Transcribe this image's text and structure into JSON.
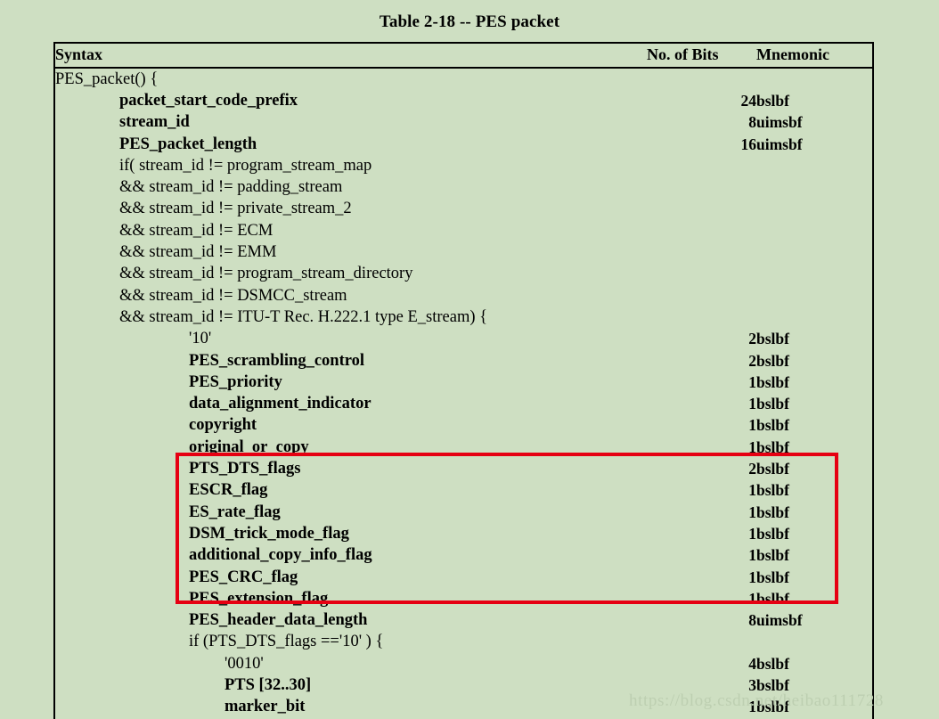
{
  "title": "Table 2-18 -- PES packet",
  "colors": {
    "page_background": "#cedfc2",
    "highlight_box": "#e60012",
    "table_border": "#000000",
    "watermark": "#bdcfb1"
  },
  "table": {
    "headers": {
      "syntax": "Syntax",
      "bits": "No. of Bits",
      "mnemonic": "Mnemonic"
    },
    "rows": [
      {
        "indent": 0,
        "bold": false,
        "syntax": "PES_packet() {",
        "bits": "",
        "mnemonic": ""
      },
      {
        "indent": 1,
        "bold": true,
        "syntax": "packet_start_code_prefix",
        "bits": "24",
        "mnemonic": "bslbf"
      },
      {
        "indent": 1,
        "bold": true,
        "syntax": "stream_id",
        "bits": "8",
        "mnemonic": "uimsbf"
      },
      {
        "indent": 1,
        "bold": true,
        "syntax": "PES_packet_length",
        "bits": "16",
        "mnemonic": "uimsbf"
      },
      {
        "indent": 1,
        "bold": false,
        "syntax": "if( stream_id != program_stream_map",
        "bits": "",
        "mnemonic": ""
      },
      {
        "indent": 1,
        "bold": false,
        "syntax": "&& stream_id != padding_stream",
        "bits": "",
        "mnemonic": ""
      },
      {
        "indent": 1,
        "bold": false,
        "syntax": "&& stream_id != private_stream_2",
        "bits": "",
        "mnemonic": ""
      },
      {
        "indent": 1,
        "bold": false,
        "syntax": "&& stream_id != ECM",
        "bits": "",
        "mnemonic": ""
      },
      {
        "indent": 1,
        "bold": false,
        "syntax": "&& stream_id != EMM",
        "bits": "",
        "mnemonic": ""
      },
      {
        "indent": 1,
        "bold": false,
        "syntax": "&& stream_id != program_stream_directory",
        "bits": "",
        "mnemonic": ""
      },
      {
        "indent": 1,
        "bold": false,
        "syntax": "&& stream_id != DSMCC_stream",
        "bits": "",
        "mnemonic": ""
      },
      {
        "indent": 1,
        "bold": false,
        "syntax": "&& stream_id != ITU-T Rec. H.222.1 type E_stream) {",
        "bits": "",
        "mnemonic": ""
      },
      {
        "indent": 2,
        "bold": false,
        "syntax": "'10'",
        "bits": "2",
        "mnemonic": "bslbf"
      },
      {
        "indent": 2,
        "bold": true,
        "syntax": "PES_scrambling_control",
        "bits": "2",
        "mnemonic": "bslbf"
      },
      {
        "indent": 2,
        "bold": true,
        "syntax": "PES_priority",
        "bits": "1",
        "mnemonic": "bslbf"
      },
      {
        "indent": 2,
        "bold": true,
        "syntax": "data_alignment_indicator",
        "bits": "1",
        "mnemonic": "bslbf"
      },
      {
        "indent": 2,
        "bold": true,
        "syntax": "copyright",
        "bits": "1",
        "mnemonic": "bslbf"
      },
      {
        "indent": 2,
        "bold": true,
        "syntax": "original_or_copy",
        "bits": "1",
        "mnemonic": "bslbf"
      },
      {
        "indent": 2,
        "bold": true,
        "syntax": "PTS_DTS_flags",
        "bits": "2",
        "mnemonic": "bslbf"
      },
      {
        "indent": 2,
        "bold": true,
        "syntax": "ESCR_flag",
        "bits": "1",
        "mnemonic": "bslbf"
      },
      {
        "indent": 2,
        "bold": true,
        "syntax": "ES_rate_flag",
        "bits": "1",
        "mnemonic": "bslbf"
      },
      {
        "indent": 2,
        "bold": true,
        "syntax": "DSM_trick_mode_flag",
        "bits": "1",
        "mnemonic": "bslbf"
      },
      {
        "indent": 2,
        "bold": true,
        "syntax": "additional_copy_info_flag",
        "bits": "1",
        "mnemonic": "bslbf"
      },
      {
        "indent": 2,
        "bold": true,
        "syntax": "PES_CRC_flag",
        "bits": "1",
        "mnemonic": "bslbf"
      },
      {
        "indent": 2,
        "bold": true,
        "syntax": "PES_extension_flag",
        "bits": "1",
        "mnemonic": "bslbf"
      },
      {
        "indent": 2,
        "bold": true,
        "syntax": "PES_header_data_length",
        "bits": "8",
        "mnemonic": "uimsbf"
      },
      {
        "indent": 2,
        "bold": false,
        "syntax": "if (PTS_DTS_flags =='10' ) {",
        "bits": "",
        "mnemonic": ""
      },
      {
        "indent": 3,
        "bold": false,
        "syntax": "'0010'",
        "bits": "4",
        "mnemonic": "bslbf"
      },
      {
        "indent": 3,
        "bold": true,
        "syntax": "PTS [32..30]",
        "bits": "3",
        "mnemonic": "bslbf"
      },
      {
        "indent": 3,
        "bold": true,
        "syntax": "marker_bit",
        "bits": "1",
        "mnemonic": "bslbf"
      }
    ]
  },
  "watermark": "https://blog.csdn.net/heibao111728"
}
